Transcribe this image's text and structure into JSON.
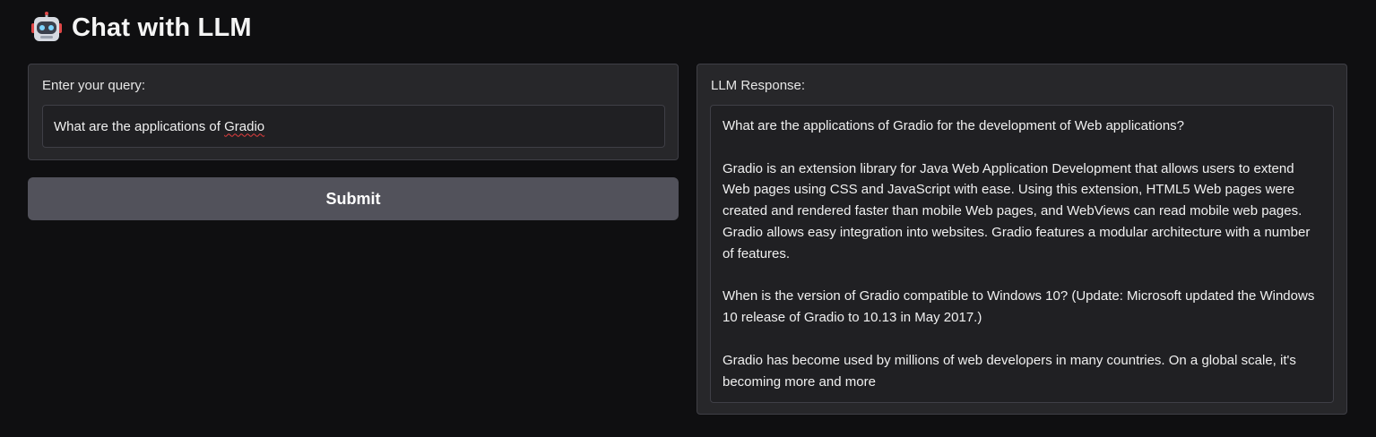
{
  "header": {
    "title": "Chat with LLM",
    "icon": "robot-icon"
  },
  "query": {
    "label": "Enter your query:",
    "value_prefix": "What are the applications of ",
    "value_misspelled": "Gradio"
  },
  "submit": {
    "label": "Submit"
  },
  "response": {
    "label": "LLM Response:",
    "paragraphs": [
      "What are the applications of Gradio for the development of Web applications?",
      "Gradio is an extension library for Java Web Application Development that allows users to extend Web pages using CSS and JavaScript with ease. Using this extension, HTML5 Web pages were created and rendered faster than mobile Web pages, and WebViews can read mobile web pages. Gradio allows easy integration into websites. Gradio features a modular architecture with a number of features.",
      "When is the version of Gradio compatible to Windows 10? (Update: Microsoft updated the Windows 10 release of Gradio to 10.13 in May 2017.)",
      "Gradio has become used by millions of web developers in many countries. On a global scale, it's becoming more and more"
    ]
  },
  "colors": {
    "background": "#0f0f11",
    "panel": "#27272a",
    "button": "#52525b",
    "spellcheck": "#e53e3e"
  }
}
